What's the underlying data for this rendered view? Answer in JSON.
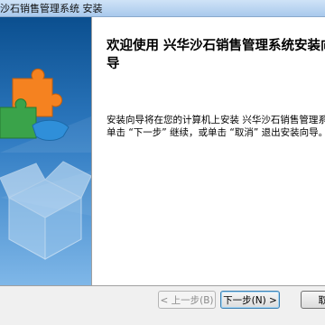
{
  "window": {
    "title": "沙石销售管理系统 安装"
  },
  "content": {
    "heading": "欢迎使用 兴华沙石销售管理系统安装向导",
    "description": "安装向导将在您的计算机上安装 兴华沙石销售管理系统。单击 “下一步” 继续，或单击 “取消” 退出安装向导。"
  },
  "buttons": {
    "back": "< 上一步(B)",
    "next": "下一步(N) >",
    "cancel": "取消"
  },
  "colors": {
    "panel_top": "#0b4f8f",
    "panel_bottom": "#7fb7e8",
    "puzzle_orange": "#f58220",
    "puzzle_green": "#3aa34a",
    "puzzle_blue": "#2f8fd9"
  },
  "icons": {
    "banner": "puzzle-box-icon"
  }
}
